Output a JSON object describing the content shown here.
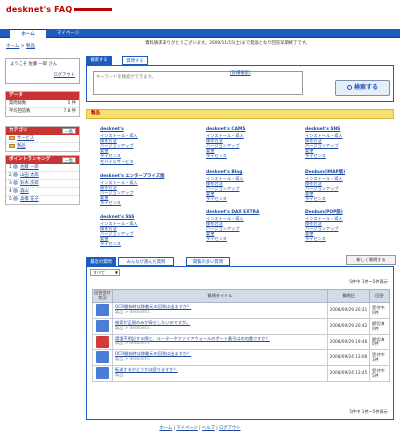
{
  "logo": {
    "text": "desknet's FAQ"
  },
  "nav": {
    "tabs": [
      {
        "label": "ホーム",
        "active": true
      },
      {
        "label": "マイページ",
        "active": false
      }
    ]
  },
  "breadcrumb": {
    "home": "ホーム",
    "sep": ">",
    "current": "製品"
  },
  "notice": "資料請求ありがとうございます。2009/11/15(土)まで発送となり回答早期終了です。",
  "welcome": {
    "greeting": "ようこそ 佐藤 一郎 さん",
    "logout": "ログアウト"
  },
  "data_box": {
    "title": "データ",
    "rows": [
      {
        "label": "質問総数",
        "value": "5 件"
      },
      {
        "label": "平均回答数",
        "value": "7.8 件"
      }
    ]
  },
  "category_box": {
    "title": "カテゴリ",
    "button": "一覧",
    "items": [
      "サービス",
      "製品"
    ]
  },
  "ranking_box": {
    "title": "ポイントランキング",
    "button": "一覧",
    "items": [
      {
        "rank": "1",
        "name": "佐藤 一郎"
      },
      {
        "rank": "2",
        "name": "山田 太郎"
      },
      {
        "rank": "3",
        "name": "鈴木 次郎"
      },
      {
        "rank": "4",
        "name": "森山"
      },
      {
        "rank": "5",
        "name": "高橋 花子"
      }
    ]
  },
  "search": {
    "tabs": [
      "検索する",
      "質問する"
    ],
    "placeholder": "キーワードを検索ができます。",
    "advanced": "[詳細検索]",
    "button": "検索する"
  },
  "categories": {
    "title": "製品",
    "columns": [
      [
        {
          "title": "desknet's",
          "items": [
            "インストール・導入",
            "操作方法",
            "バージョンアップ",
            "要望",
            "ライセンス",
            "モバイルサービス"
          ]
        },
        {
          "title": "desknet's エンタープライズ版",
          "items": [
            "インストール・導入",
            "操作方法",
            "バージョンアップ",
            "要望",
            "ライセンス"
          ]
        },
        {
          "title": "desknet's SSS",
          "items": [
            "インストール・導入",
            "操作方法",
            "バージョンアップ",
            "要望",
            "ライセンス"
          ]
        }
      ],
      [
        {
          "title": "desknet's CAMS",
          "items": [
            "インストール・導入",
            "操作方法",
            "バージョンアップ",
            "要望",
            "ライセンス"
          ]
        },
        {
          "title": "desknet's Blog",
          "items": [
            "インストール・導入",
            "操作方法",
            "バージョンアップ",
            "要望",
            "ライセンス"
          ]
        },
        {
          "title": "desknet's DAX EXTRA",
          "items": [
            "インストール・導入",
            "操作方法",
            "バージョンアップ",
            "要望",
            "ライセンス"
          ]
        }
      ],
      [
        {
          "title": "desknet's SNS",
          "items": [
            "インストール・導入",
            "操作方法",
            "バージョンアップ",
            "要望",
            "ライセンス"
          ]
        },
        {
          "title": "Denbun(IMAP版)",
          "items": [
            "インストール・導入",
            "操作方法",
            "バージョンアップ",
            "要望",
            "ライセンス"
          ]
        },
        {
          "title": "Denbun(POP版)",
          "items": [
            "インストール・導入",
            "操作方法",
            "バージョンアップ",
            "要望",
            "ライセンス"
          ]
        }
      ]
    ]
  },
  "questions": {
    "tabs": [
      "最近の質問",
      "みんなが選んだ質問",
      "関覧の多い質問"
    ],
    "new_button": "新しく質問する",
    "filter": "すべて",
    "count_top": "5件中 1件～5件表示",
    "count_bottom": "5件中 1件～5件表示",
    "headers": [
      "回答受付状況",
      "質問タイトル",
      "質問日",
      "回答"
    ],
    "rows": [
      {
        "status": "open",
        "title": "OCR開始時は移動元の回答は出ますか？",
        "path": "製品 > desknet's",
        "date": "2008/09/29 20:31",
        "answers": "受付中 0件"
      },
      {
        "status": "open",
        "title": "検索が正規のみが探せしたいのですが。",
        "path": "製品 > desknet's",
        "date": "2008/09/29 20:42",
        "answers": "締切済 0件"
      },
      {
        "status": "closed",
        "title": "環境不明記する際と、ルーターやファイアウォールのポート番号はの何番ですか？",
        "path": "製品 > desknet's",
        "date": "2008/09/29 19:46",
        "answers": "締切済 0件"
      },
      {
        "status": "open",
        "title": "OCR開始時は移動元の回答は出ますか？",
        "path": "製品 > desknet's",
        "date": "2008/09/24 13:06",
        "answers": "受付中 3件"
      },
      {
        "status": "open",
        "title": "転送するかどうかは読りますか？",
        "path": "製品",
        "date": "2008/09/24 13:45",
        "answers": "受付中 5件"
      }
    ]
  },
  "footer": {
    "links": [
      "ホーム",
      "マイページ",
      "ヘルプ",
      "ログアウト"
    ]
  },
  "colors": {
    "nav_blue": "#1d5bbf",
    "accent_red": "#ca3333",
    "category_yellow": "#f7df6e"
  }
}
